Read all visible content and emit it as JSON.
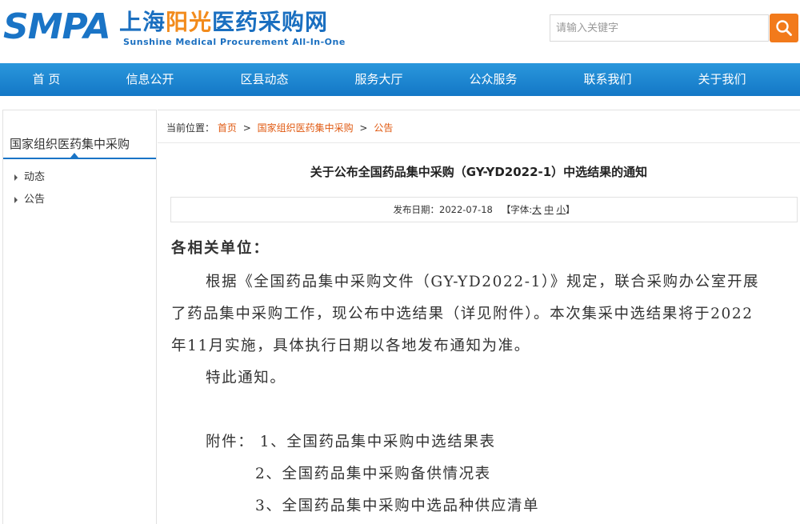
{
  "header": {
    "logo_abbr": "SMPA",
    "logo_cn_prefix": "上海",
    "logo_cn_highlight": "阳光",
    "logo_cn_suffix": "医药采购网",
    "logo_en": "Sunshine Medical Procurement All-In-One",
    "search_placeholder": "请输入关键字"
  },
  "nav": {
    "items": [
      "首 页",
      "信息公开",
      "区县动态",
      "服务大厅",
      "公众服务",
      "联系我们",
      "关于我们"
    ]
  },
  "sidebar": {
    "title": "国家组织医药集中采购",
    "items": [
      "动态",
      "公告"
    ]
  },
  "breadcrumb": {
    "prefix": "当前位置：",
    "home": "首页",
    "level1": "国家组织医药集中采购",
    "level2": "公告",
    "separator": ">"
  },
  "article": {
    "title": "关于公布全国药品集中采购（GY-YD2022-1）中选结果的通知",
    "publish_label": "发布日期：",
    "publish_date": "2022-07-18",
    "font_label_prefix": "【字体:",
    "font_large": "大",
    "font_medium": "中",
    "font_small": "小",
    "font_label_suffix": "】",
    "greeting": "各相关单位：",
    "para_line1": "根据《全国药品集中采购文件（GY-YD2022-1）》规定，联合采购办公室开展",
    "para_line2": "了药品集中采购工作，现公布中选结果（详见附件）。本次集采中选结果将于2022",
    "para_line3": "年11月实施，具体执行日期以各地发布通知为准。",
    "notice": "特此通知。",
    "attachment_1": "附件： 1、全国药品集中采购中选结果表",
    "attachment_2": "2、全国药品集中采购备供情况表",
    "attachment_3": "3、全国药品集中采购中选品种供应清单"
  },
  "colors": {
    "brand_blue": "#1a74c6",
    "nav_blue": "#1e86d0",
    "accent_orange": "#f27a1b",
    "link_orange": "#e05a12"
  }
}
